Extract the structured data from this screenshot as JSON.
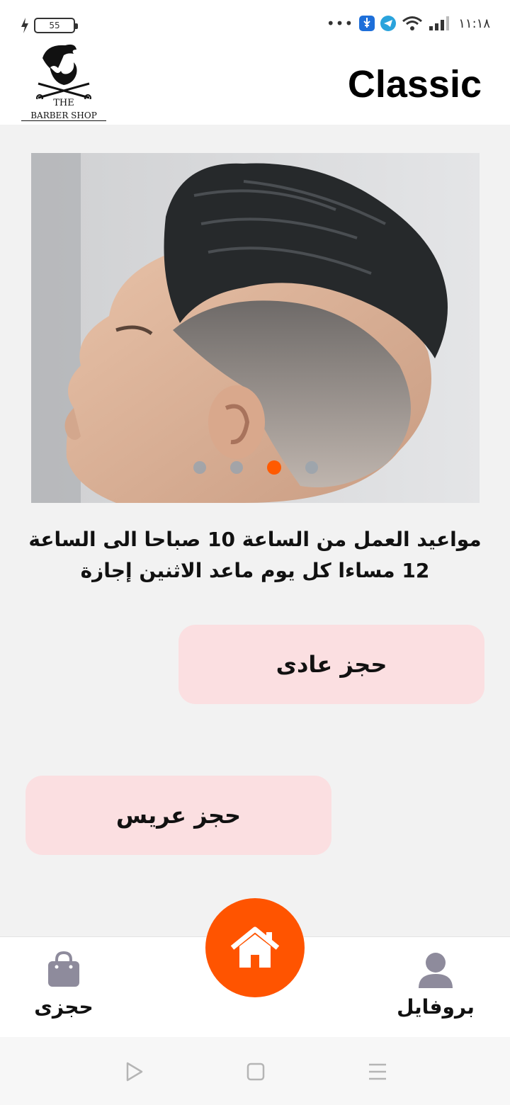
{
  "status_bar": {
    "battery_level": "55",
    "time": "١١:١٨",
    "dots": "•••"
  },
  "header": {
    "logo_line1": "THE",
    "logo_line2": "BARBER SHOP",
    "title": "Classic"
  },
  "carousel": {
    "slide_count": 4,
    "active_index": 2,
    "image_subject": "man-with-fade-haircut-profile"
  },
  "info": {
    "line1": "مواعيد العمل من الساعة 10 صباحا الى الساعة",
    "line2": "12 مساءا كل يوم  ماعد الاثنين إجازة"
  },
  "buttons": {
    "normal_booking": "حجز عادى",
    "groom_booking": "حجز عريس"
  },
  "bottom_nav": {
    "bookings_label": "حجزى",
    "bookings_icon": "shopping-bag-icon",
    "home_icon": "home-icon",
    "profile_label": "بروفايل",
    "profile_icon": "user-icon"
  },
  "colors": {
    "accent": "#ff5400",
    "button_bg": "#fbdfe1",
    "nav_icon": "#8e8b9c",
    "dot_inactive": "#9aa3ad"
  }
}
